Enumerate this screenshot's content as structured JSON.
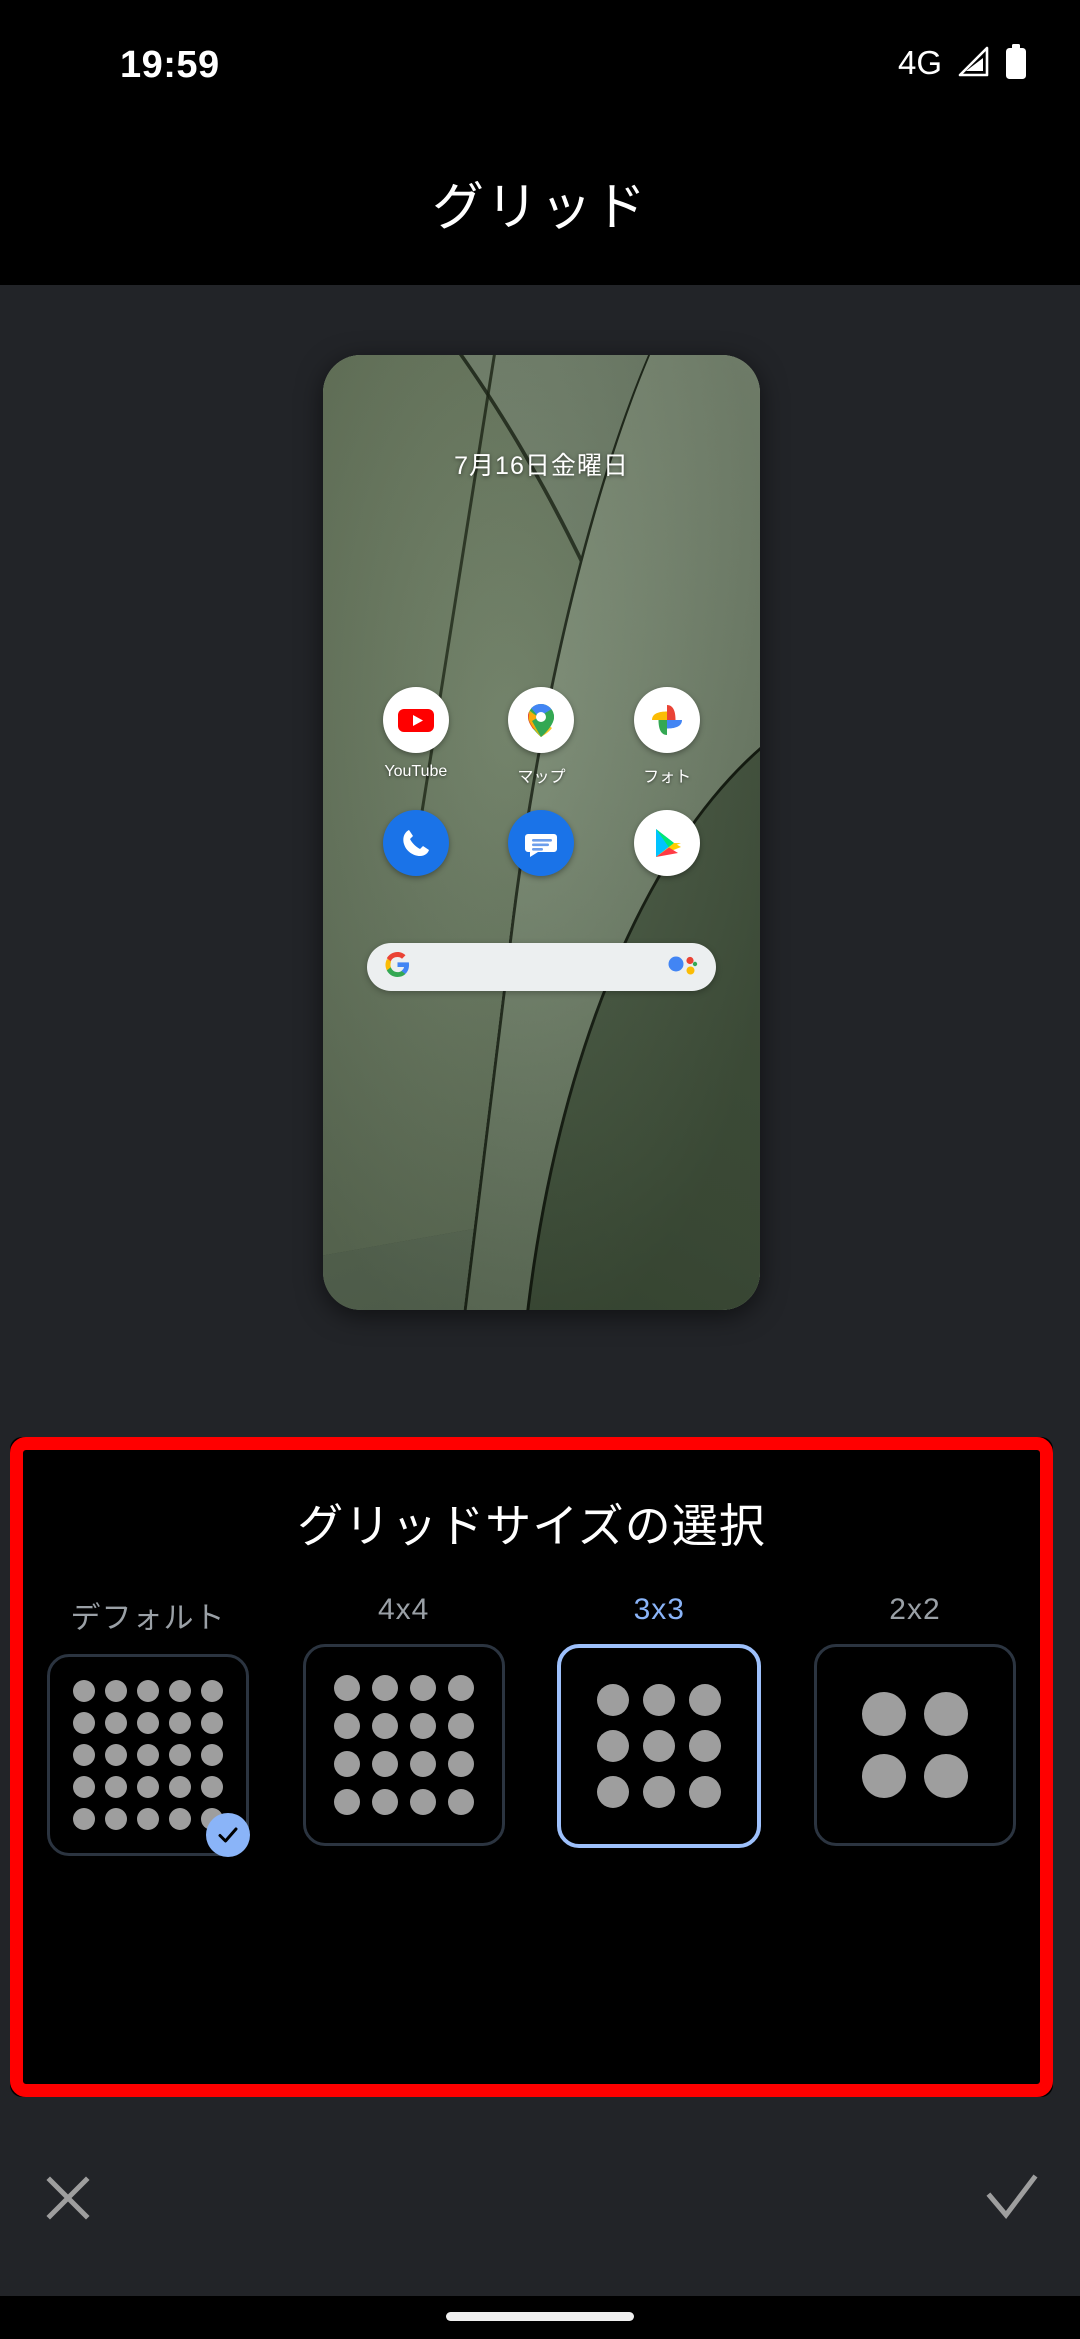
{
  "status_bar": {
    "time": "19:59",
    "network": "4G",
    "signal_icon": "signal-triangle-icon",
    "battery_icon": "battery-full-icon"
  },
  "app_bar": {
    "title": "グリッド"
  },
  "preview": {
    "date": "7月16日金曜日",
    "apps_row1": [
      {
        "label": "YouTube",
        "icon": "youtube-icon"
      },
      {
        "label": "マップ",
        "icon": "google-maps-icon"
      },
      {
        "label": "フォト",
        "icon": "google-photos-icon"
      }
    ],
    "apps_row2": [
      {
        "label": "",
        "icon": "phone-icon"
      },
      {
        "label": "",
        "icon": "messages-icon"
      },
      {
        "label": "",
        "icon": "play-store-icon"
      }
    ],
    "search": {
      "placeholder": "",
      "value": "",
      "left_icon": "google-g-icon",
      "right_icon": "google-assistant-icon"
    }
  },
  "grid_panel": {
    "title": "グリッドサイズの選択",
    "highlight_color": "#ff0000",
    "selected_color": "#8ab4f8",
    "options": [
      {
        "label": "デフォルト",
        "cols": 5,
        "rows": 5,
        "dot": 22,
        "gap": 10,
        "checked": true,
        "focused": false
      },
      {
        "label": "4x4",
        "cols": 4,
        "rows": 4,
        "dot": 26,
        "gap": 12,
        "checked": false,
        "focused": false
      },
      {
        "label": "3x3",
        "cols": 3,
        "rows": 3,
        "dot": 32,
        "gap": 14,
        "checked": false,
        "focused": true
      },
      {
        "label": "2x2",
        "cols": 2,
        "rows": 2,
        "dot": 44,
        "gap": 18,
        "checked": false,
        "focused": false
      }
    ]
  },
  "action_bar": {
    "cancel_icon": "close-x-icon",
    "confirm_icon": "check-icon"
  },
  "nav_bar": {
    "home_indicator": "home-pill-indicator"
  }
}
